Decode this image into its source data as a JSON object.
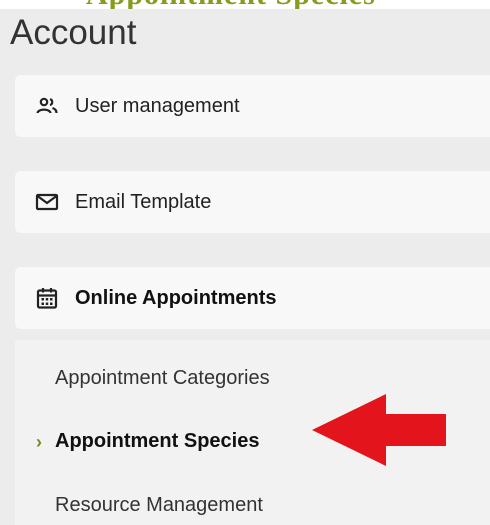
{
  "sidebar": {
    "title": "Account",
    "cards": [
      {
        "label": "User management",
        "icon": "users-icon"
      },
      {
        "label": "Email Template",
        "icon": "envelope-icon"
      },
      {
        "label": "Online Appointments",
        "icon": "calendar-icon"
      }
    ],
    "submenu": [
      {
        "label": "Appointment Categories"
      },
      {
        "label": "Appointment Species",
        "active": true
      },
      {
        "label": "Resource Management"
      }
    ],
    "active_marker": "›"
  },
  "colors": {
    "background": "#ececec",
    "card": "#f8f8f8",
    "accent": "#7a8a1a",
    "arrow": "#e3141b"
  }
}
